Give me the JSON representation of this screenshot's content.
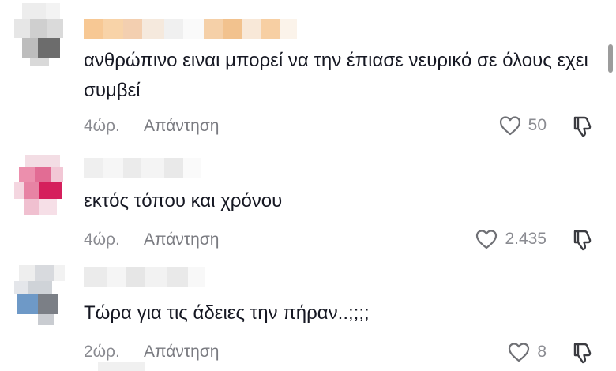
{
  "comments": [
    {
      "text": "ανθρώπινο ειναι μπορεί να την έπιασε νευρικό σε όλους εχει συμβεί",
      "time": "4ώρ.",
      "reply_label": "Απάντηση",
      "likes": "50"
    },
    {
      "text": "εκτός τόπου και χρόνου",
      "time": "4ώρ.",
      "reply_label": "Απάντηση",
      "likes": "2.435"
    },
    {
      "text": "Τώρα για τις άδειες την πήραν..;;;;",
      "time": "2ώρ.",
      "reply_label": "Απάντηση",
      "likes": "8"
    }
  ],
  "icons": {
    "like": "heart-outline-icon",
    "dislike": "thumbs-down-icon"
  },
  "colors": {
    "text": "#161823",
    "meta": "#8a8b91"
  }
}
